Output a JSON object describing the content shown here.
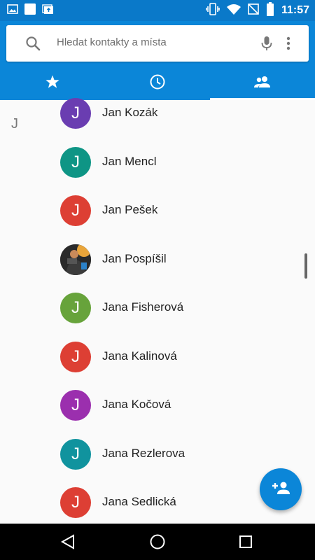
{
  "status_bar": {
    "time": "11:57",
    "icons": [
      "image-icon",
      "square-notification-icon",
      "photo-upload-icon",
      "vibrate-icon",
      "wifi-icon",
      "no-sim-icon",
      "battery-icon"
    ]
  },
  "search": {
    "placeholder": "Hledat kontakty a místa",
    "icons": [
      "search-icon",
      "microphone-icon",
      "more-vert-icon"
    ]
  },
  "tabs": [
    {
      "icon": "star-icon",
      "active": false
    },
    {
      "icon": "clock-icon",
      "active": false
    },
    {
      "icon": "contacts-icon",
      "active": true
    }
  ],
  "list": {
    "section_letter": "J",
    "contacts": [
      {
        "name": "Jan Kozák",
        "initial": "J",
        "color": "#6a3db1"
      },
      {
        "name": "Jan Mencl",
        "initial": "J",
        "color": "#0e9585"
      },
      {
        "name": "Jan Pešek",
        "initial": "J",
        "color": "#dd3f34"
      },
      {
        "name": "Jan Pospíšil",
        "initial": "",
        "color": "#1d1d1d",
        "photo": true
      },
      {
        "name": "Jana Fisherová",
        "initial": "J",
        "color": "#67a33b"
      },
      {
        "name": "Jana Kalinová",
        "initial": "J",
        "color": "#dd3f34"
      },
      {
        "name": "Jana Kočová",
        "initial": "J",
        "color": "#9b2fae"
      },
      {
        "name": "Jana Rezlerova",
        "initial": "J",
        "color": "#10939e"
      },
      {
        "name": "Jana Sedlická",
        "initial": "J",
        "color": "#dd3f34"
      }
    ]
  },
  "fab": {
    "icon": "add-contact-icon"
  },
  "nav": {
    "icons": [
      "back-icon",
      "home-icon",
      "recents-icon"
    ]
  },
  "colors": {
    "primary": "#0b86d8",
    "status_bar": "#0a79c9"
  }
}
